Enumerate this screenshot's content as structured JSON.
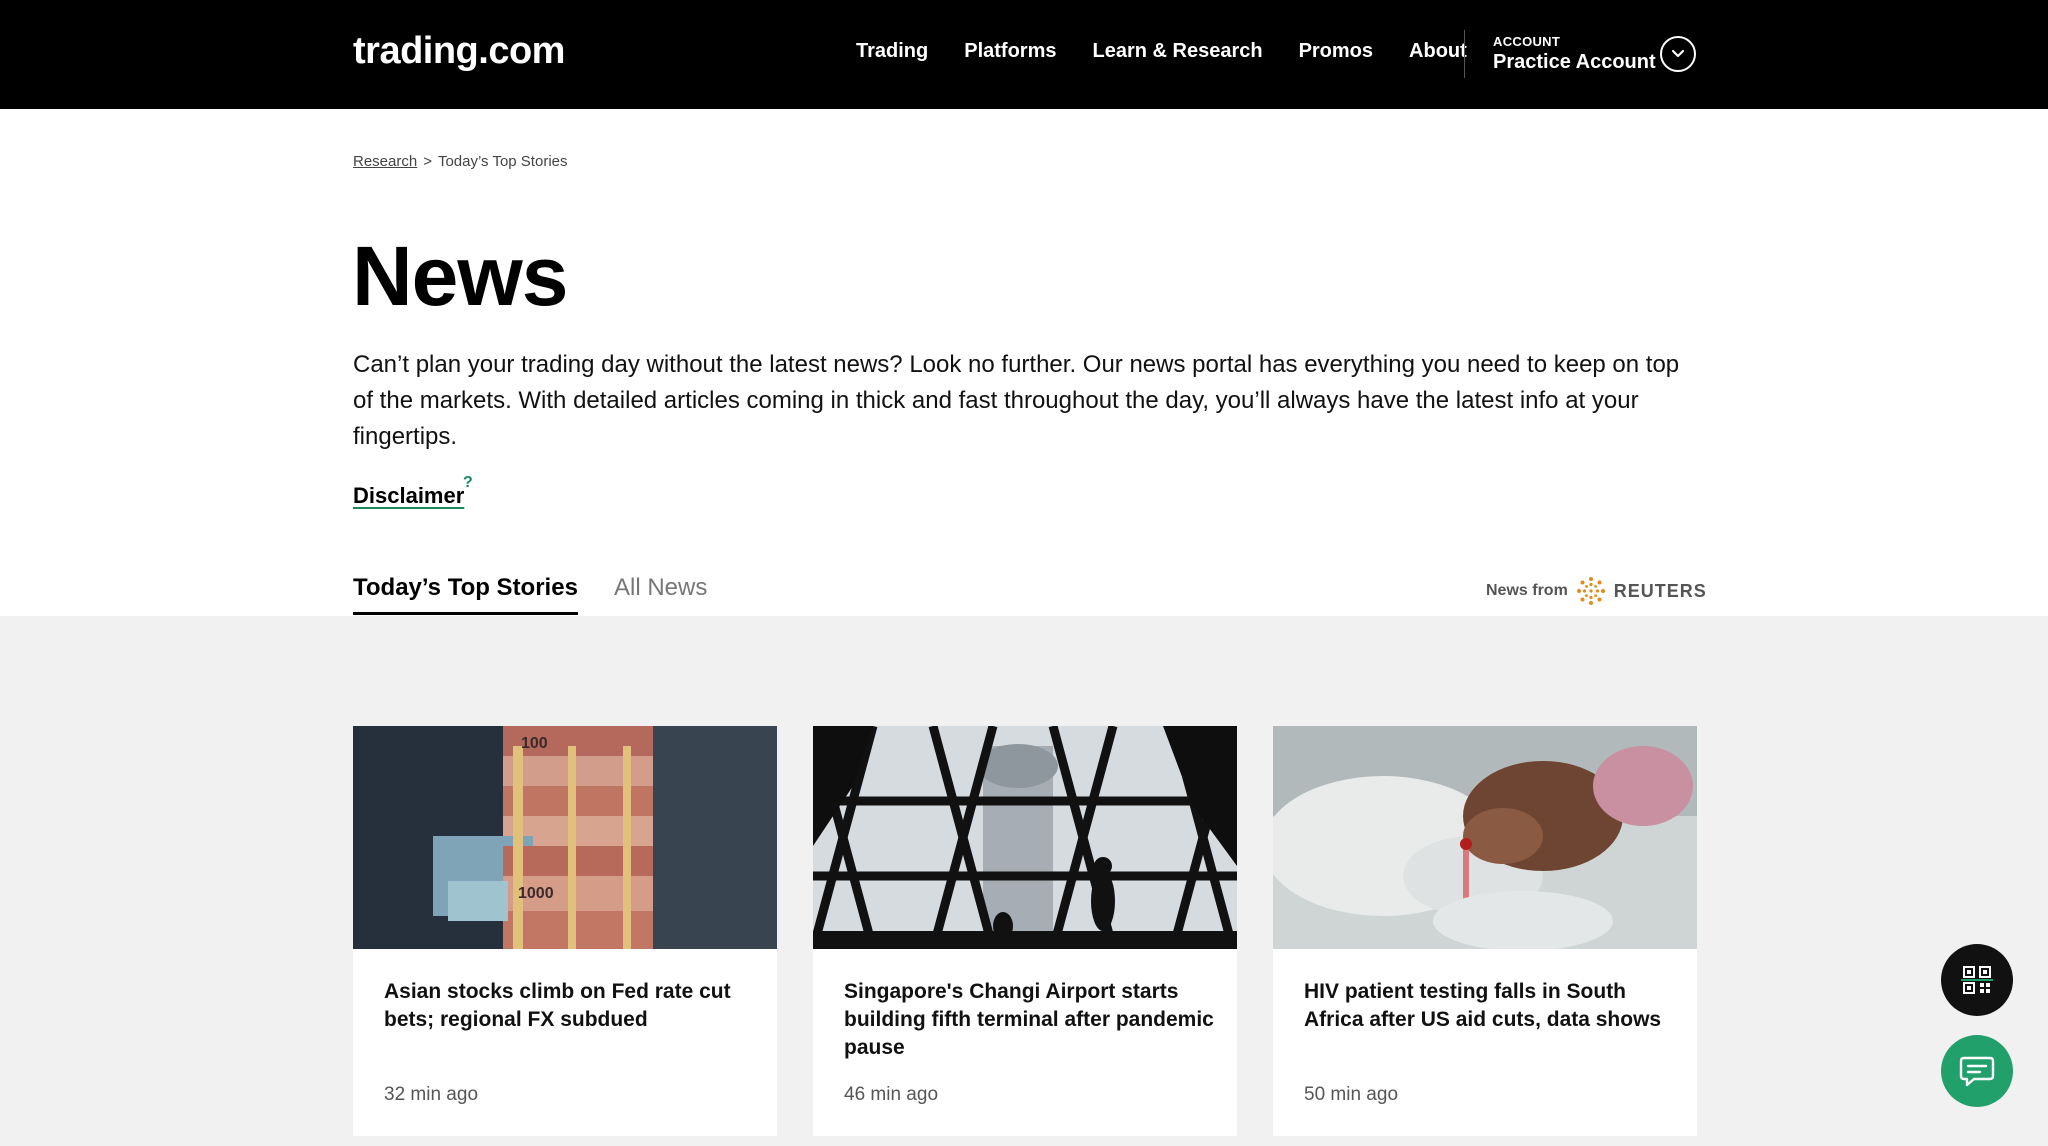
{
  "header": {
    "logo": "trading.com",
    "nav": [
      "Trading",
      "Platforms",
      "Learn & Research",
      "Promos",
      "About"
    ],
    "account_small": "ACCOUNT",
    "account_name": "Practice Account"
  },
  "breadcrumb": {
    "link": "Research",
    "separator": ">",
    "current": "Today’s Top Stories"
  },
  "page": {
    "title": "News",
    "intro": "Can’t plan your trading day without the latest news? Look no further. Our news portal has everything you need to keep on top of the markets. With detailed articles coming in thick and fast throughout the day, you’ll always have the latest info at your fingertips.",
    "disclaimer": "Disclaimer",
    "disclaimer_marker": "?"
  },
  "tabs": {
    "active": "Today’s Top Stories",
    "inactive": "All News"
  },
  "news_source": {
    "label": "News from",
    "brand": "REUTERS"
  },
  "stories": [
    {
      "title": "Asian stocks climb on Fed rate cut bets; regional FX subdued",
      "time": "32 min ago"
    },
    {
      "title": "Singapore's Changi Airport starts building fifth terminal after pandemic pause",
      "time": "46 min ago"
    },
    {
      "title": "HIV patient testing falls in South Africa after US aid cuts, data shows",
      "time": "50 min ago"
    }
  ],
  "colors": {
    "header_bg": "#000000",
    "accent_green": "#22a06b",
    "stories_bg": "#f1f1f1"
  },
  "icons": {
    "account_toggle": "chevron-down-icon",
    "qr": "qr-code-icon",
    "chat": "chat-bubble-icon",
    "reuters": "reuters-logo-icon"
  }
}
